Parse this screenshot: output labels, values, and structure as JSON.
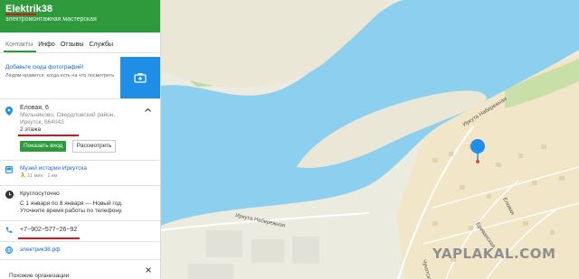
{
  "org": {
    "name": "Elektrik38",
    "category": "электромонтажная мастерская"
  },
  "tabs": [
    "Контакты",
    "Инфо",
    "Отзывы",
    "Службы"
  ],
  "photo": {
    "link": "Добавьте сюда фотографий!",
    "hint": "Людям нравится, когда есть на что посмотреть"
  },
  "address": {
    "street": "Еловая, 6",
    "line2": "Мельниково, Свердловский район,",
    "line3": "Иркутск, 664043",
    "floors": "2 этажа",
    "show_entrance": "Показать вход",
    "consider": "Рассмотреть"
  },
  "transit": {
    "stop": "Музей истории Иркутска",
    "walk": "11 мин · 1 км"
  },
  "hours": {
    "status": "Круглосуточно",
    "note": "С 1 января по 8 января — Новый год. Уточните время работы по телефону."
  },
  "phone": "+7−902−577−26−92",
  "website": "электрик38.рф",
  "similar": "Похожие организации",
  "map": {
    "street1": "Иркута Набережная",
    "street2": "Иркута Набережная",
    "street3": "Еловая",
    "street4": "Ереванская",
    "street5": "Чукотская"
  },
  "watermark": "YAPLAKAL.COM",
  "colors": {
    "header": "#2f9a3c",
    "link": "#1a64c8",
    "river": "#8dcfef",
    "camera_button": "#1e8ee6",
    "underline": "#d8141c"
  }
}
